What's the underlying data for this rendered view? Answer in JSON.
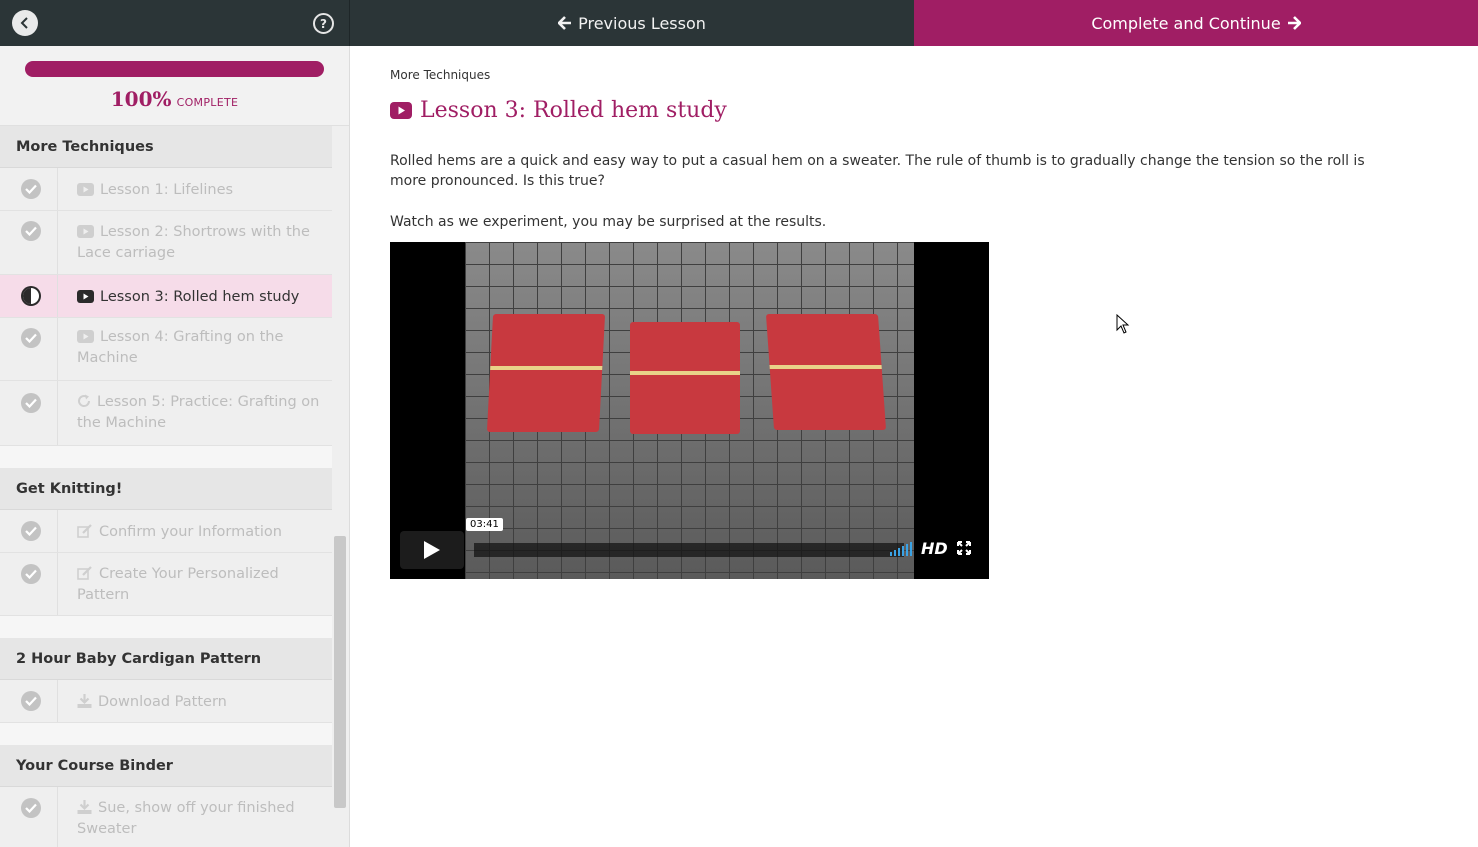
{
  "topbar": {
    "prev_label": "Previous Lesson",
    "next_label": "Complete and Continue"
  },
  "progress": {
    "percent_text": "100%",
    "label": "COMPLETE",
    "fraction": 1.0
  },
  "sections": [
    {
      "title": "More Techniques",
      "items": [
        {
          "label": "Lesson 1: Lifelines",
          "icon": "video-icon",
          "status": "complete"
        },
        {
          "label": "Lesson 2: Shortrows with the Lace carriage",
          "icon": "video-icon",
          "status": "complete"
        },
        {
          "label": "Lesson 3: Rolled hem study",
          "icon": "video-icon",
          "status": "in-progress"
        },
        {
          "label": "Lesson 4: Grafting on the Machine",
          "icon": "video-icon",
          "status": "complete"
        },
        {
          "label": "Lesson 5: Practice: Grafting on the Machine",
          "icon": "refresh-icon",
          "status": "complete"
        }
      ]
    },
    {
      "title": "Get Knitting!",
      "items": [
        {
          "label": "Confirm your Information",
          "icon": "edit-icon",
          "status": "complete"
        },
        {
          "label": "Create Your Personalized Pattern",
          "icon": "edit-icon",
          "status": "complete"
        }
      ]
    },
    {
      "title": "2 Hour Baby Cardigan Pattern",
      "items": [
        {
          "label": "Download Pattern",
          "icon": "download-icon",
          "status": "complete"
        }
      ]
    },
    {
      "title": "Your Course Binder",
      "items": [
        {
          "label": "Sue, show off your finished Sweater",
          "icon": "download-icon",
          "status": "complete"
        }
      ]
    }
  ],
  "main": {
    "breadcrumb": "More Techniques",
    "title": "Lesson 3: Rolled hem study",
    "paragraph1": "Rolled hems are a quick and easy way to put a casual hem on a sweater. The rule of thumb is to gradually change the tension so the roll is more pronounced. Is this true?",
    "paragraph2": "Watch as we experiment, you may be surprised at the results."
  },
  "video": {
    "time": "03:41",
    "hd_label": "HD"
  },
  "colors": {
    "accent": "#a01e64",
    "topbar": "#2b3537",
    "active_item": "#f6dce9"
  }
}
